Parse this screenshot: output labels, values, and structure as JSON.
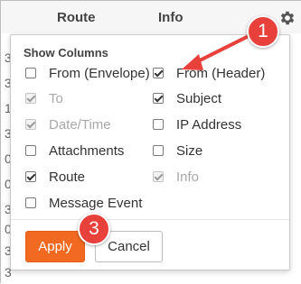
{
  "table": {
    "columns": [
      "Route",
      "Info"
    ],
    "settings_icon": "gear-icon",
    "left_edge_fragments": [
      "3",
      "3",
      "1",
      "3",
      "0",
      "0",
      "3",
      "0",
      "3",
      "3"
    ]
  },
  "panel": {
    "title": "Show Columns",
    "options_left": [
      {
        "label": "From (Envelope)",
        "checked": false,
        "disabled": false
      },
      {
        "label": "To",
        "checked": true,
        "disabled": true
      },
      {
        "label": "Date/Time",
        "checked": true,
        "disabled": true
      },
      {
        "label": "Attachments",
        "checked": false,
        "disabled": false
      },
      {
        "label": "Route",
        "checked": true,
        "disabled": false
      },
      {
        "label": "Message Event",
        "checked": false,
        "disabled": false
      }
    ],
    "options_right": [
      {
        "label": "From (Header)",
        "checked": true,
        "disabled": false
      },
      {
        "label": "Subject",
        "checked": true,
        "disabled": false
      },
      {
        "label": "IP Address",
        "checked": false,
        "disabled": false
      },
      {
        "label": "Size",
        "checked": false,
        "disabled": false
      },
      {
        "label": "Info",
        "checked": true,
        "disabled": true
      }
    ],
    "apply_label": "Apply",
    "cancel_label": "Cancel"
  },
  "annotations": {
    "callout_1": "1",
    "callout_3": "3",
    "color": "#e8403a"
  },
  "colors": {
    "apply_button": "#f26a22"
  }
}
